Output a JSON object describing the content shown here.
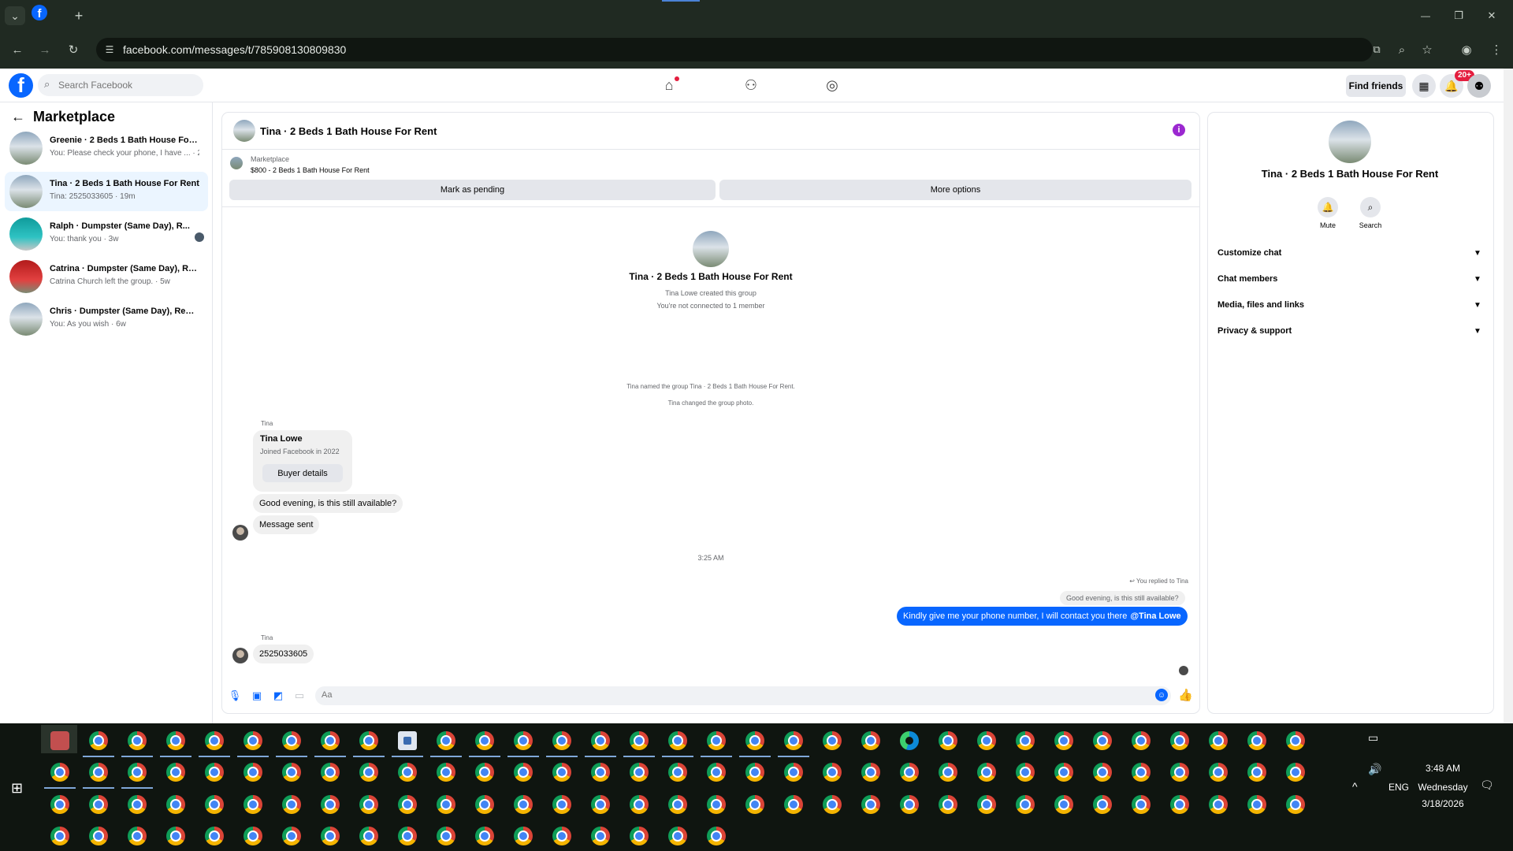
{
  "browser": {
    "url": "facebook.com/messages/t/785908130809830",
    "tab_icon": "facebook-icon",
    "new_tab": "+",
    "tab_menu": "⌄",
    "back": "←",
    "forward": "→",
    "reload": "↻",
    "minimize": "—",
    "restore": "❐",
    "close": "✕"
  },
  "fb_header": {
    "logo": "f",
    "search_placeholder": "Search Facebook",
    "find_friends_label": "Find friends",
    "notification_count": "20+"
  },
  "sidebar": {
    "title": "Marketplace",
    "conversations": [
      {
        "name": "Greenie · 2 Beds 1 Bath House For ...",
        "preview": "You: Please check your phone, I have ... · 2m",
        "thumb": "house"
      },
      {
        "name": "Tina · 2 Beds 1 Bath House For Rent",
        "preview": "Tina: 2525033605 · 19m",
        "thumb": "house",
        "active": true
      },
      {
        "name": "Ralph · Dumpster (Same Day), R...",
        "preview": "You: thank you · 3w",
        "thumb": "teal"
      },
      {
        "name": "Catrina · Dumpster (Same Day), Re...",
        "preview": "Catrina Church left the group. · 5w",
        "thumb": "red"
      },
      {
        "name": "Chris · Dumpster (Same Day), Rental",
        "preview": "You: As you wish · 6w",
        "thumb": "house"
      }
    ]
  },
  "chat": {
    "title": "Tina · 2 Beds 1 Bath House For Rent",
    "marketplace_label": "Marketplace",
    "listing": "$800 - 2 Beds 1 Bath House For Rent",
    "mark_pending_label": "Mark as pending",
    "more_options_label": "More options",
    "group_name": "Tina · 2 Beds 1 Bath House For Rent",
    "group_created": "Tina Lowe created this group",
    "group_not_connected": "You're not connected to 1 member",
    "system_named": "Tina named the group Tina · 2 Beds 1 Bath House For Rent.",
    "system_photo": "Tina changed the group photo.",
    "sender_1": "Tina",
    "buyer_name": "Tina Lowe",
    "buyer_joined": "Joined Facebook in 2022",
    "buyer_details_label": "Buyer details",
    "msg_1": "Good evening, is this still available?",
    "msg_2": "Message sent",
    "time_divider": "3:25 AM",
    "replied_label": "You replied to Tina",
    "quoted_msg": "Good evening, is this still available?",
    "my_msg": "Kindly give me your phone number, I will contact you there",
    "my_msg_mention": "@Tina Lowe",
    "sender_2": "Tina",
    "msg_3": "2525033605",
    "composer_placeholder": "Aa"
  },
  "right_panel": {
    "name": "Tina · 2 Beds 1 Bath House For Rent",
    "mute_label": "Mute",
    "search_label": "Search",
    "rows": [
      "Customize chat",
      "Chat members",
      "Media, files and links",
      "Privacy & support"
    ]
  },
  "taskbar": {
    "time": "3:48 AM",
    "day": "Wednesday",
    "date": "3/18/2026",
    "lang": "ENG"
  },
  "colors": {
    "brand": "#0866ff",
    "chrome_bg": "#202a22",
    "taskbar_bg": "#0f1510",
    "info_icon": "#9b28d0"
  }
}
